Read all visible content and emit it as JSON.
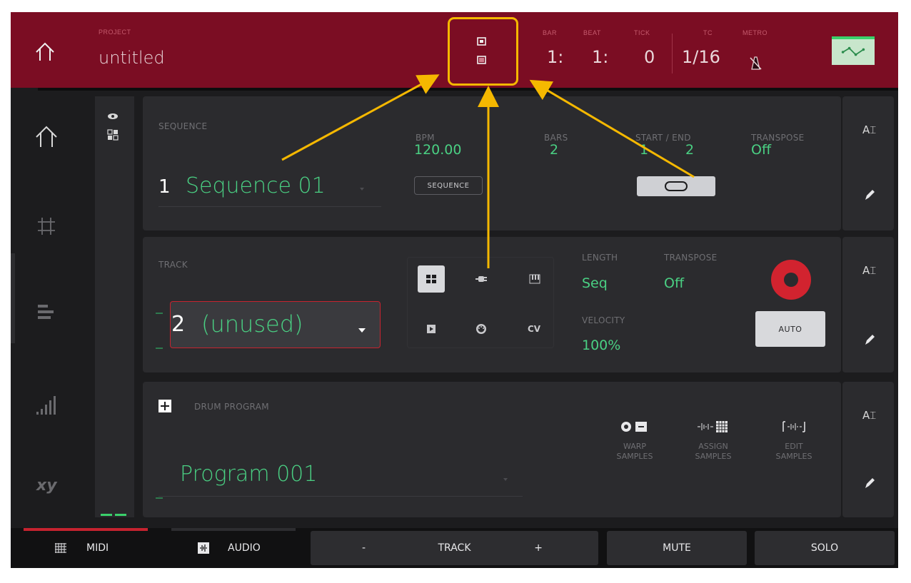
{
  "header": {
    "project_label": "PROJECT",
    "project_name": "untitled",
    "bar": {
      "label": "BAR",
      "value": "1:"
    },
    "beat": {
      "label": "BEAT",
      "value": "1:"
    },
    "tick": {
      "label": "TICK",
      "value": "0"
    },
    "tc": {
      "label": "TC",
      "value": "1/16"
    },
    "metro": {
      "label": "METRO",
      "icon": "metronome-muted-icon"
    },
    "automation_icon": "automation-graph-icon"
  },
  "left_nav": [
    "home-icon",
    "grid-icon",
    "bars-icon",
    "levels-icon",
    "xy-icon"
  ],
  "sequence": {
    "label": "SEQUENCE",
    "number": "1",
    "name": "Sequence 01",
    "bpm_label": "BPM",
    "bpm": "120.00",
    "bpm_mode": "SEQUENCE",
    "bars_label": "BARS",
    "bars": "2",
    "start_end_label": "START / END",
    "start": "1",
    "end": "2",
    "transpose_label": "TRANSPOSE",
    "transpose": "Off"
  },
  "track": {
    "label": "TRACK",
    "number": "2",
    "name": "(unused)",
    "types": [
      "drum-icon",
      "plugin-icon",
      "keygroup-icon",
      "clip-icon",
      "midi-icon",
      "CV"
    ],
    "length_label": "LENGTH",
    "length": "Seq",
    "transpose_label": "TRANSPOSE",
    "transpose": "Off",
    "velocity_label": "VELOCITY",
    "velocity": "100%",
    "auto_label": "AUTO"
  },
  "program": {
    "label": "DRUM PROGRAM",
    "name": "Program 001",
    "warp": [
      "WARP",
      "SAMPLES"
    ],
    "assign": [
      "ASSIGN",
      "SAMPLES"
    ],
    "edit": [
      "EDIT",
      "SAMPLES"
    ]
  },
  "bottom": {
    "midi": "MIDI",
    "audio": "AUDIO",
    "minus": "-",
    "track": "TRACK",
    "plus": "+",
    "mute": "MUTE",
    "solo": "SOLO"
  },
  "colors": {
    "header_bg": "#7b0d23",
    "accent_green": "#4ad083",
    "record_red": "#d2232f",
    "callout_yellow": "#f5b800"
  }
}
